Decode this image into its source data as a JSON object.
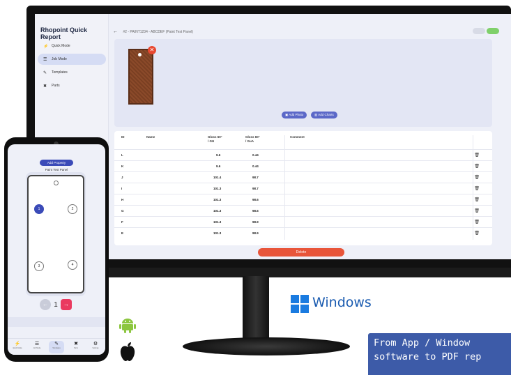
{
  "app": {
    "title": "Rhopoint Quick Report",
    "breadcrumb": "#2 - PAINT1234 - ABCDEF (Paint Test Panel)"
  },
  "sidebar": {
    "items": [
      {
        "label": "Quick Mode",
        "icon": "bolt-icon"
      },
      {
        "label": "Job Mode",
        "icon": "list-icon"
      },
      {
        "label": "Templates",
        "icon": "edit-icon"
      },
      {
        "label": "Parts",
        "icon": "tools-icon"
      }
    ]
  },
  "photos": {
    "add_photo": "Add Photo",
    "add_charts": "Add Charts"
  },
  "table": {
    "headers": {
      "id": "ID",
      "name": "Name",
      "gloss60": "Gloss 60°\n/ GU",
      "gloss60b": "Gloss 60°\n/ GuA",
      "comment": "Comment"
    },
    "rows": [
      {
        "id": "L",
        "g1": "9.6",
        "g2": "0.44"
      },
      {
        "id": "K",
        "g1": "9.6",
        "g2": "0.44"
      },
      {
        "id": "J",
        "g1": "101.4",
        "g2": "98.7"
      },
      {
        "id": "I",
        "g1": "101.3",
        "g2": "98.7"
      },
      {
        "id": "H",
        "g1": "101.3",
        "g2": "98.6"
      },
      {
        "id": "G",
        "g1": "101.3",
        "g2": "98.6"
      },
      {
        "id": "F",
        "g1": "101.3",
        "g2": "98.9"
      },
      {
        "id": "E",
        "g1": "101.3",
        "g2": "98.9"
      }
    ],
    "delete_label": "Delete"
  },
  "phone": {
    "add_property": "Add Property",
    "panel_title": "Paint Test Panel",
    "points": [
      "1",
      "2",
      "3",
      "4"
    ],
    "current_point": "1",
    "nav": [
      {
        "icon": "bolt-icon",
        "label": "Quick Mode"
      },
      {
        "icon": "list-icon",
        "label": "Job Mode"
      },
      {
        "icon": "edit-icon",
        "label": "Templates"
      },
      {
        "icon": "tools-icon",
        "label": "Parts"
      },
      {
        "icon": "gear-icon",
        "label": "Settings"
      }
    ]
  },
  "logos": {
    "windows_label": "Windows"
  },
  "banner": {
    "line1": "From App / Window",
    "line2": "software to PDF rep"
  },
  "colors": {
    "accent": "#5b68c8",
    "danger": "#e8553a",
    "banner": "#3d5ba8",
    "windows_blue": "#1a7be0",
    "android_green": "#8cc63f"
  }
}
